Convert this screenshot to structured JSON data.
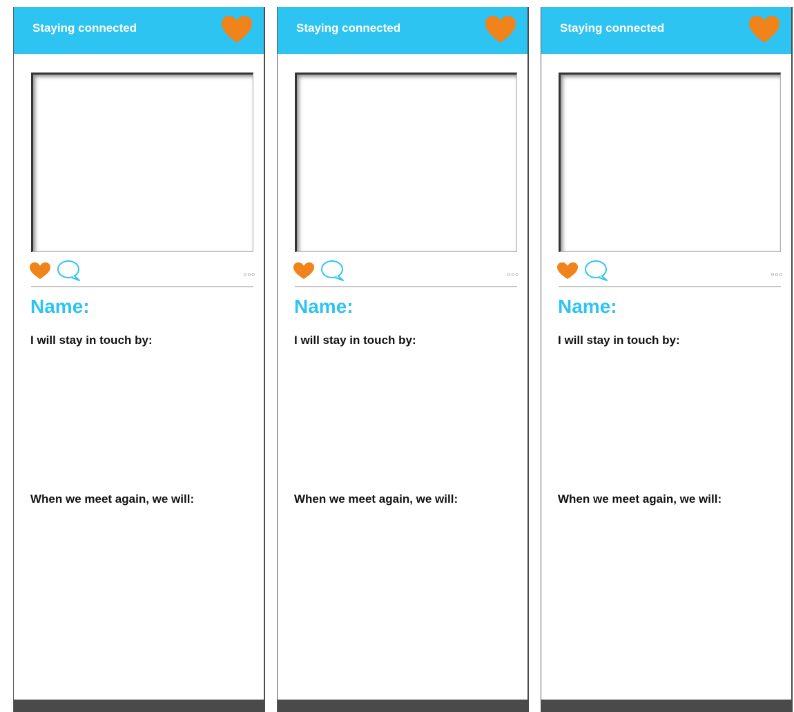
{
  "card": {
    "title": "Staying connected",
    "name_label": "Name:",
    "prompt_stay_in_touch": "I will stay in touch by:",
    "prompt_meet_again": "When we meet again, we will:",
    "more_dots": "○○○"
  },
  "colors": {
    "header": "#2ec4f1",
    "heart": "#f0831a",
    "accent_text": "#2ec4f1",
    "footer": "#4a4a4a"
  },
  "icons": [
    "heart-icon",
    "comment-bubble-icon",
    "more-dots-icon"
  ]
}
